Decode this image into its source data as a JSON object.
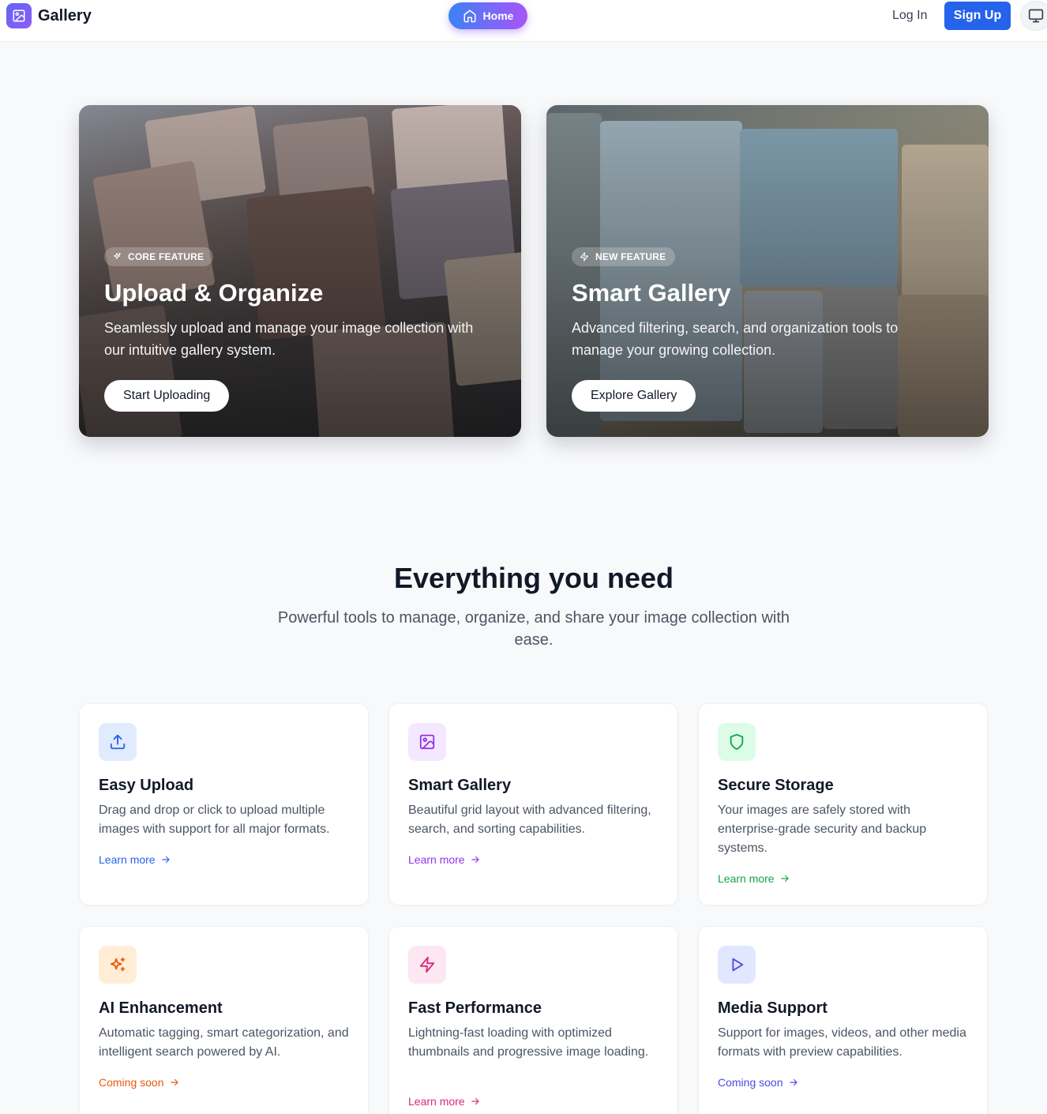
{
  "header": {
    "brand": "Gallery",
    "nav_home": "Home",
    "login": "Log In",
    "signup": "Sign Up"
  },
  "hero": [
    {
      "badge": "CORE FEATURE",
      "title": "Upload & Organize",
      "description": "Seamlessly upload and manage your image collection with our intuitive gallery system.",
      "button": "Start Uploading"
    },
    {
      "badge": "NEW FEATURE",
      "title": "Smart Gallery",
      "description": "Advanced filtering, search, and organization tools to manage your growing collection.",
      "button": "Explore Gallery"
    }
  ],
  "section": {
    "title": "Everything you need",
    "subtitle": "Powerful tools to manage, organize, and share your image collection with ease."
  },
  "features": [
    {
      "icon": "upload-icon",
      "title": "Easy Upload",
      "description": "Drag and drop or click to upload multiple images with support for all major formats.",
      "link": "Learn more",
      "color": "#2563eb",
      "bg": "#e0ebfd"
    },
    {
      "icon": "image-icon",
      "title": "Smart Gallery",
      "description": "Beautiful grid layout with advanced filtering, search, and sorting capabilities.",
      "link": "Learn more",
      "color": "#9333ea",
      "bg": "#f3e8ff"
    },
    {
      "icon": "shield-icon",
      "title": "Secure Storage",
      "description": "Your images are safely stored with enterprise-grade security and backup systems.",
      "link": "Learn more",
      "color": "#16a34a",
      "bg": "#dcfce7"
    },
    {
      "icon": "sparkles-icon",
      "title": "AI Enhancement",
      "description": "Automatic tagging, smart categorization, and intelligent search powered by AI.",
      "link": "Coming soon",
      "color": "#ea580c",
      "bg": "#ffedd5"
    },
    {
      "icon": "zap-icon",
      "title": "Fast Performance",
      "description": "Lightning-fast loading with optimized thumbnails and progressive image loading.",
      "link": "Learn more",
      "color": "#db2777",
      "bg": "#fce7f3"
    },
    {
      "icon": "play-icon",
      "title": "Media Support",
      "description": "Support for images, videos, and other media formats with preview capabilities.",
      "link": "Coming soon",
      "color": "#4f46e5",
      "bg": "#e0e7ff"
    }
  ]
}
